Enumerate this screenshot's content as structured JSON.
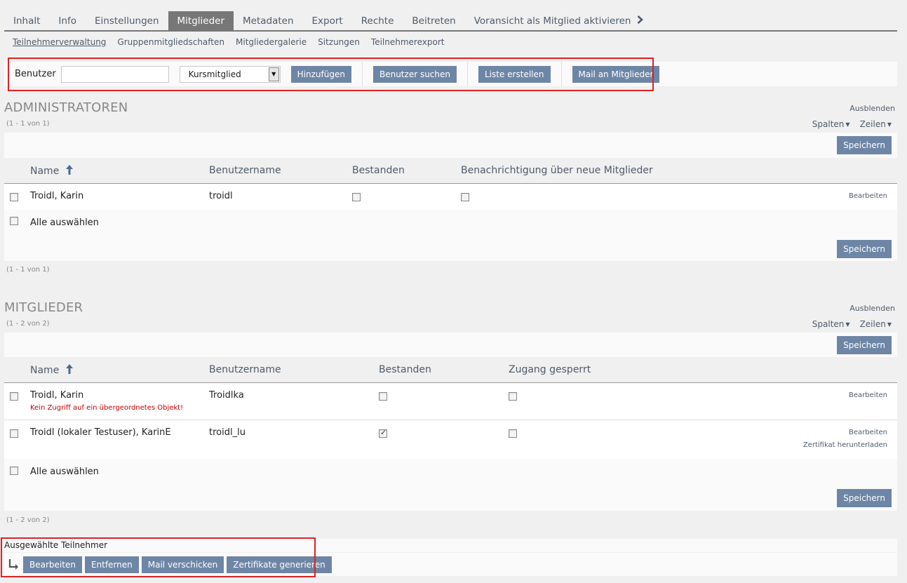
{
  "tabs": [
    {
      "label": "Inhalt"
    },
    {
      "label": "Info"
    },
    {
      "label": "Einstellungen"
    },
    {
      "label": "Mitglieder"
    },
    {
      "label": "Metadaten"
    },
    {
      "label": "Export"
    },
    {
      "label": "Rechte"
    },
    {
      "label": "Beitreten"
    },
    {
      "label": "Voransicht als Mitglied aktivieren"
    }
  ],
  "active_tab": "Mitglieder",
  "subtabs": [
    {
      "label": "Teilnehmerverwaltung"
    },
    {
      "label": "Gruppenmitgliedschaften"
    },
    {
      "label": "Mitgliedergalerie"
    },
    {
      "label": "Sitzungen"
    },
    {
      "label": "Teilnehmerexport"
    }
  ],
  "toolbar": {
    "user_label": "Benutzer",
    "user_input_value": "",
    "role_select_value": "Kursmitglied",
    "add_label": "Hinzufügen",
    "search_users_label": "Benutzer suchen",
    "create_list_label": "Liste erstellen",
    "mail_members_label": "Mail an Mitglieder"
  },
  "admins": {
    "title": "ADMINISTRATOREN",
    "count_top": "(1 - 1 von 1)",
    "count_bottom": "(1 - 1 von 1)",
    "hide_label": "Ausblenden",
    "columns_label": "Spalten",
    "rows_label": "Zeilen",
    "save_label": "Speichern",
    "headers": {
      "name": "Name",
      "username": "Benutzername",
      "passed": "Bestanden",
      "notify": "Benachrichtigung über neue Mitglieder"
    },
    "rows": [
      {
        "name": "Troidl, Karin",
        "username": "troidl",
        "passed": false,
        "notify": false,
        "edit_label": "Bearbeiten"
      }
    ],
    "select_all_label": "Alle auswählen"
  },
  "members": {
    "title": "MITGLIEDER",
    "count_top": "(1 - 2 von 2)",
    "count_bottom": "(1 - 2 von 2)",
    "hide_label": "Ausblenden",
    "columns_label": "Spalten",
    "rows_label": "Zeilen",
    "save_label": "Speichern",
    "headers": {
      "name": "Name",
      "username": "Benutzername",
      "passed": "Bestanden",
      "blocked": "Zugang gesperrt"
    },
    "rows": [
      {
        "name": "Troidl, Karin",
        "error": "Kein Zugriff auf ein übergeordnetes Objekt!",
        "username": "Troidlka",
        "passed": false,
        "blocked": false,
        "edit_label": "Bearbeiten"
      },
      {
        "name": "Troidl (lokaler Testuser), KarinE",
        "username": "troidl_lu",
        "passed": true,
        "blocked": false,
        "edit_label": "Bearbeiten",
        "certificate_label": "Zertifikat herunterladen"
      }
    ],
    "select_all_label": "Alle auswählen"
  },
  "bulk": {
    "label": "Ausgewählte Teilnehmer",
    "edit_label": "Bearbeiten",
    "remove_label": "Entfernen",
    "mail_label": "Mail verschicken",
    "certificates_label": "Zertifikate generieren"
  },
  "colors": {
    "button": "#6e86a6",
    "link": "#4d5b6b",
    "highlight_box": "#dd2222",
    "error": "#cc0000"
  }
}
